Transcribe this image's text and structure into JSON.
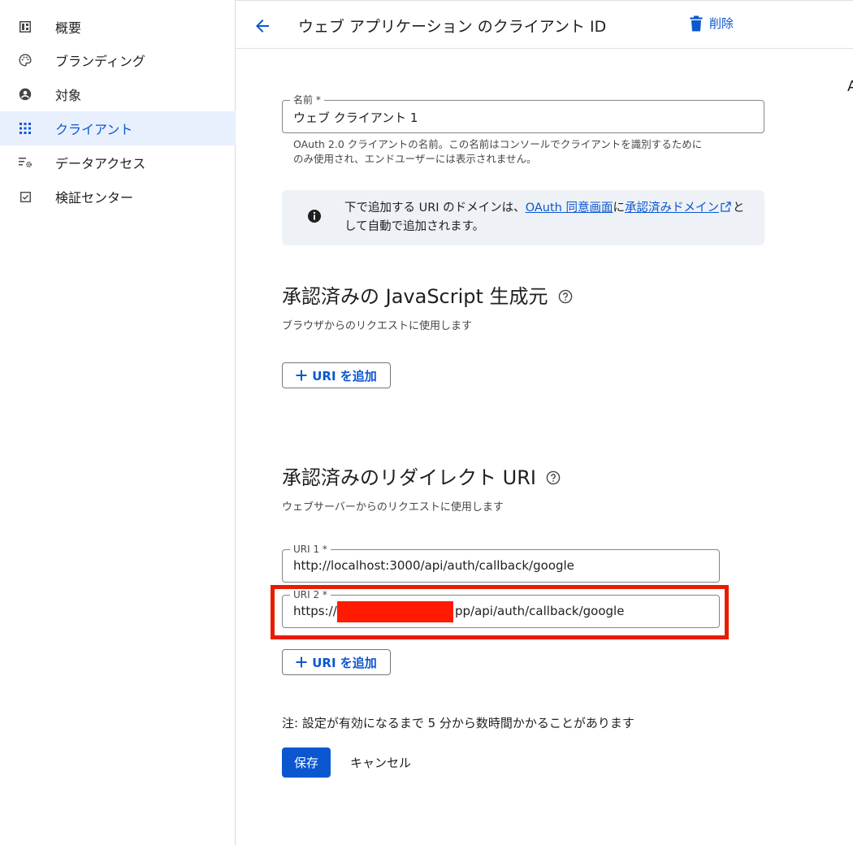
{
  "sidebar": {
    "items": [
      {
        "label": "概要",
        "icon": "dashboard-icon"
      },
      {
        "label": "ブランディング",
        "icon": "palette-icon"
      },
      {
        "label": "対象",
        "icon": "account-circle-icon"
      },
      {
        "label": "クライアント",
        "icon": "apps-grid-icon",
        "active": true
      },
      {
        "label": "データアクセス",
        "icon": "list-settings-icon"
      },
      {
        "label": "検証センター",
        "icon": "checkbox-icon"
      }
    ]
  },
  "header": {
    "title": "ウェブ アプリケーション のクライアント ID",
    "delete_label": "削除"
  },
  "clipped_text": "A",
  "name_field": {
    "label": "名前 *",
    "value": "ウェブ クライアント 1",
    "helper_line1": "OAuth 2.0 クライアントの名前。この名前はコンソールでクライアントを識別するために",
    "helper_line2": "のみ使用され、エンドユーザーには表示されません。"
  },
  "info": {
    "text_before": "下で追加する URI のドメインは、",
    "link1": "OAuth 同意画面",
    "text_mid": "に",
    "link2": "承認済みドメイン",
    "text_after": "として自動で追加されます。"
  },
  "js_origins": {
    "title": "承認済みの JavaScript 生成元",
    "subtitle": "ブラウザからのリクエストに使用します",
    "add_label": "URI を追加"
  },
  "redirect_uris": {
    "title": "承認済みのリダイレクト URI",
    "subtitle": "ウェブサーバーからのリクエストに使用します",
    "uri1_label": "URI 1 *",
    "uri1_value": "http://localhost:3000/api/auth/callback/google",
    "uri2_label": "URI 2 *",
    "uri2_prefix": "https://",
    "uri2_suffix": "pp/api/auth/callback/google",
    "add_label": "URI を追加"
  },
  "note": "注: 設定が有効になるまで 5 分から数時間かかることがあります",
  "actions": {
    "save": "保存",
    "cancel": "キャンセル"
  },
  "colors": {
    "accent": "#0b57d0",
    "highlight": "#e81c00",
    "redaction": "#ff1a00"
  }
}
